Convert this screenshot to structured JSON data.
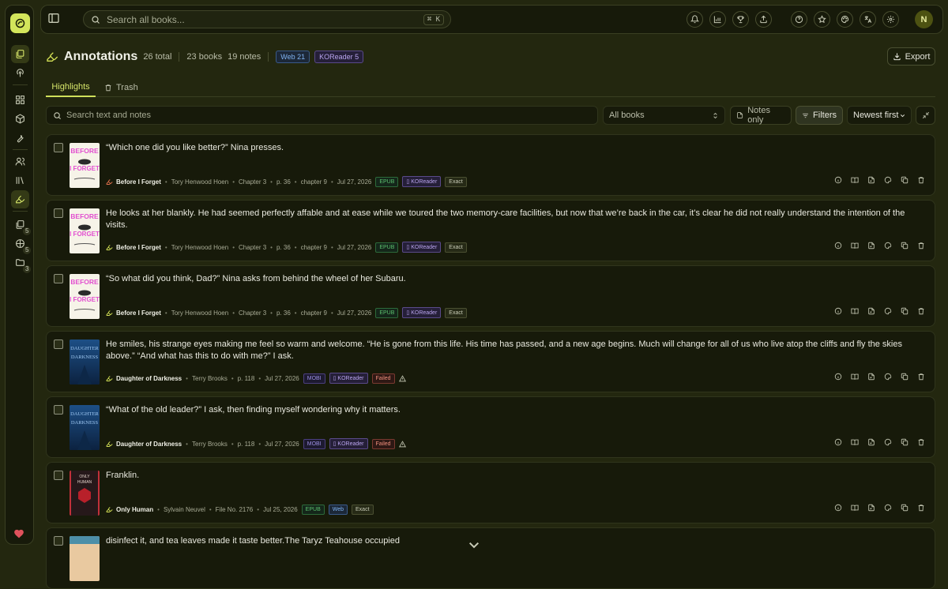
{
  "topbar": {
    "search_placeholder": "Search all books...",
    "shortcut": "⌘ K",
    "avatar": "N"
  },
  "sidebar": {
    "badges": [
      "5",
      "5",
      "3"
    ]
  },
  "header": {
    "title": "Annotations",
    "total": "26 total",
    "books": "23 books",
    "notes": "19 notes",
    "chips": [
      "Web 21",
      "KOReader 5"
    ],
    "export": "Export"
  },
  "tabs": {
    "highlights": "Highlights",
    "trash": "Trash"
  },
  "filters": {
    "search_placeholder": "Search text and notes",
    "book_select": "All books",
    "notes_only": "Notes only",
    "filters": "Filters",
    "sort": "Newest first"
  },
  "cards": [
    {
      "quote": "“Which one did you like better?” Nina presses.",
      "book": "Before I Forget",
      "author": "Tory Henwood Hoen",
      "parts": [
        "Chapter 3",
        "p. 36",
        "chapter 9",
        "Jul 27, 2026"
      ],
      "badges": [
        "EPUB",
        "KOReader",
        "Exact"
      ],
      "cover": "before"
    },
    {
      "quote": "He looks at her blankly. He had seemed perfectly affable and at ease while we toured the two memory-care facilities, but now that we’re back in the car, it’s clear he did not really understand the intention of the visits.",
      "book": "Before I Forget",
      "author": "Tory Henwood Hoen",
      "parts": [
        "Chapter 3",
        "p. 36",
        "chapter 9",
        "Jul 27, 2026"
      ],
      "badges": [
        "EPUB",
        "KOReader",
        "Exact"
      ],
      "cover": "before"
    },
    {
      "quote": "“So what did you think, Dad?” Nina asks from behind the wheel of her Subaru.",
      "book": "Before I Forget",
      "author": "Tory Henwood Hoen",
      "parts": [
        "Chapter 3",
        "p. 36",
        "chapter 9",
        "Jul 27, 2026"
      ],
      "badges": [
        "EPUB",
        "KOReader",
        "Exact"
      ],
      "cover": "before"
    },
    {
      "quote": "He smiles, his strange eyes making me feel so warm and welcome. “He is gone from this life. His time has passed, and a new age begins. Much will change for all of us who live atop the cliffs and fly the skies above.” “And what has this to do with me?” I ask.",
      "book": "Daughter of Darkness",
      "author": "Terry Brooks",
      "parts": [
        "p. 118",
        "Jul 27, 2026"
      ],
      "badges": [
        "MOBI",
        "KOReader",
        "Failed"
      ],
      "cover": "daughter"
    },
    {
      "quote": "“What of the old leader?” I ask, then finding myself wondering why it matters.",
      "book": "Daughter of Darkness",
      "author": "Terry Brooks",
      "parts": [
        "p. 118",
        "Jul 27, 2026"
      ],
      "badges": [
        "MOBI",
        "KOReader",
        "Failed"
      ],
      "cover": "daughter"
    },
    {
      "quote": "Franklin.",
      "book": "Only Human",
      "author": "Sylvain Neuvel",
      "parts": [
        "File No. 2176",
        "Jul 25, 2026"
      ],
      "badges": [
        "EPUB",
        "Web",
        "Exact"
      ],
      "cover": "human"
    },
    {
      "quote": "disinfect it, and tea leaves made it taste better.The Taryz Teahouse occupied",
      "book": "",
      "author": "",
      "parts": [],
      "badges": [],
      "cover": "tea"
    }
  ],
  "covers": {
    "before": {
      "line1": "BEFORE",
      "line2": "I FORGET",
      "bg": "#f6f3e8",
      "fg": "#e24fd0"
    },
    "daughter": {
      "line1": "DAUGHTER",
      "line2": "DARKNESS",
      "bg": "#163a66",
      "fg": "#9ec8f2"
    },
    "human": {
      "line1": "ONLY",
      "line2": "HUMAN",
      "bg": "#26181a",
      "fg": "#e0d0c8"
    }
  }
}
